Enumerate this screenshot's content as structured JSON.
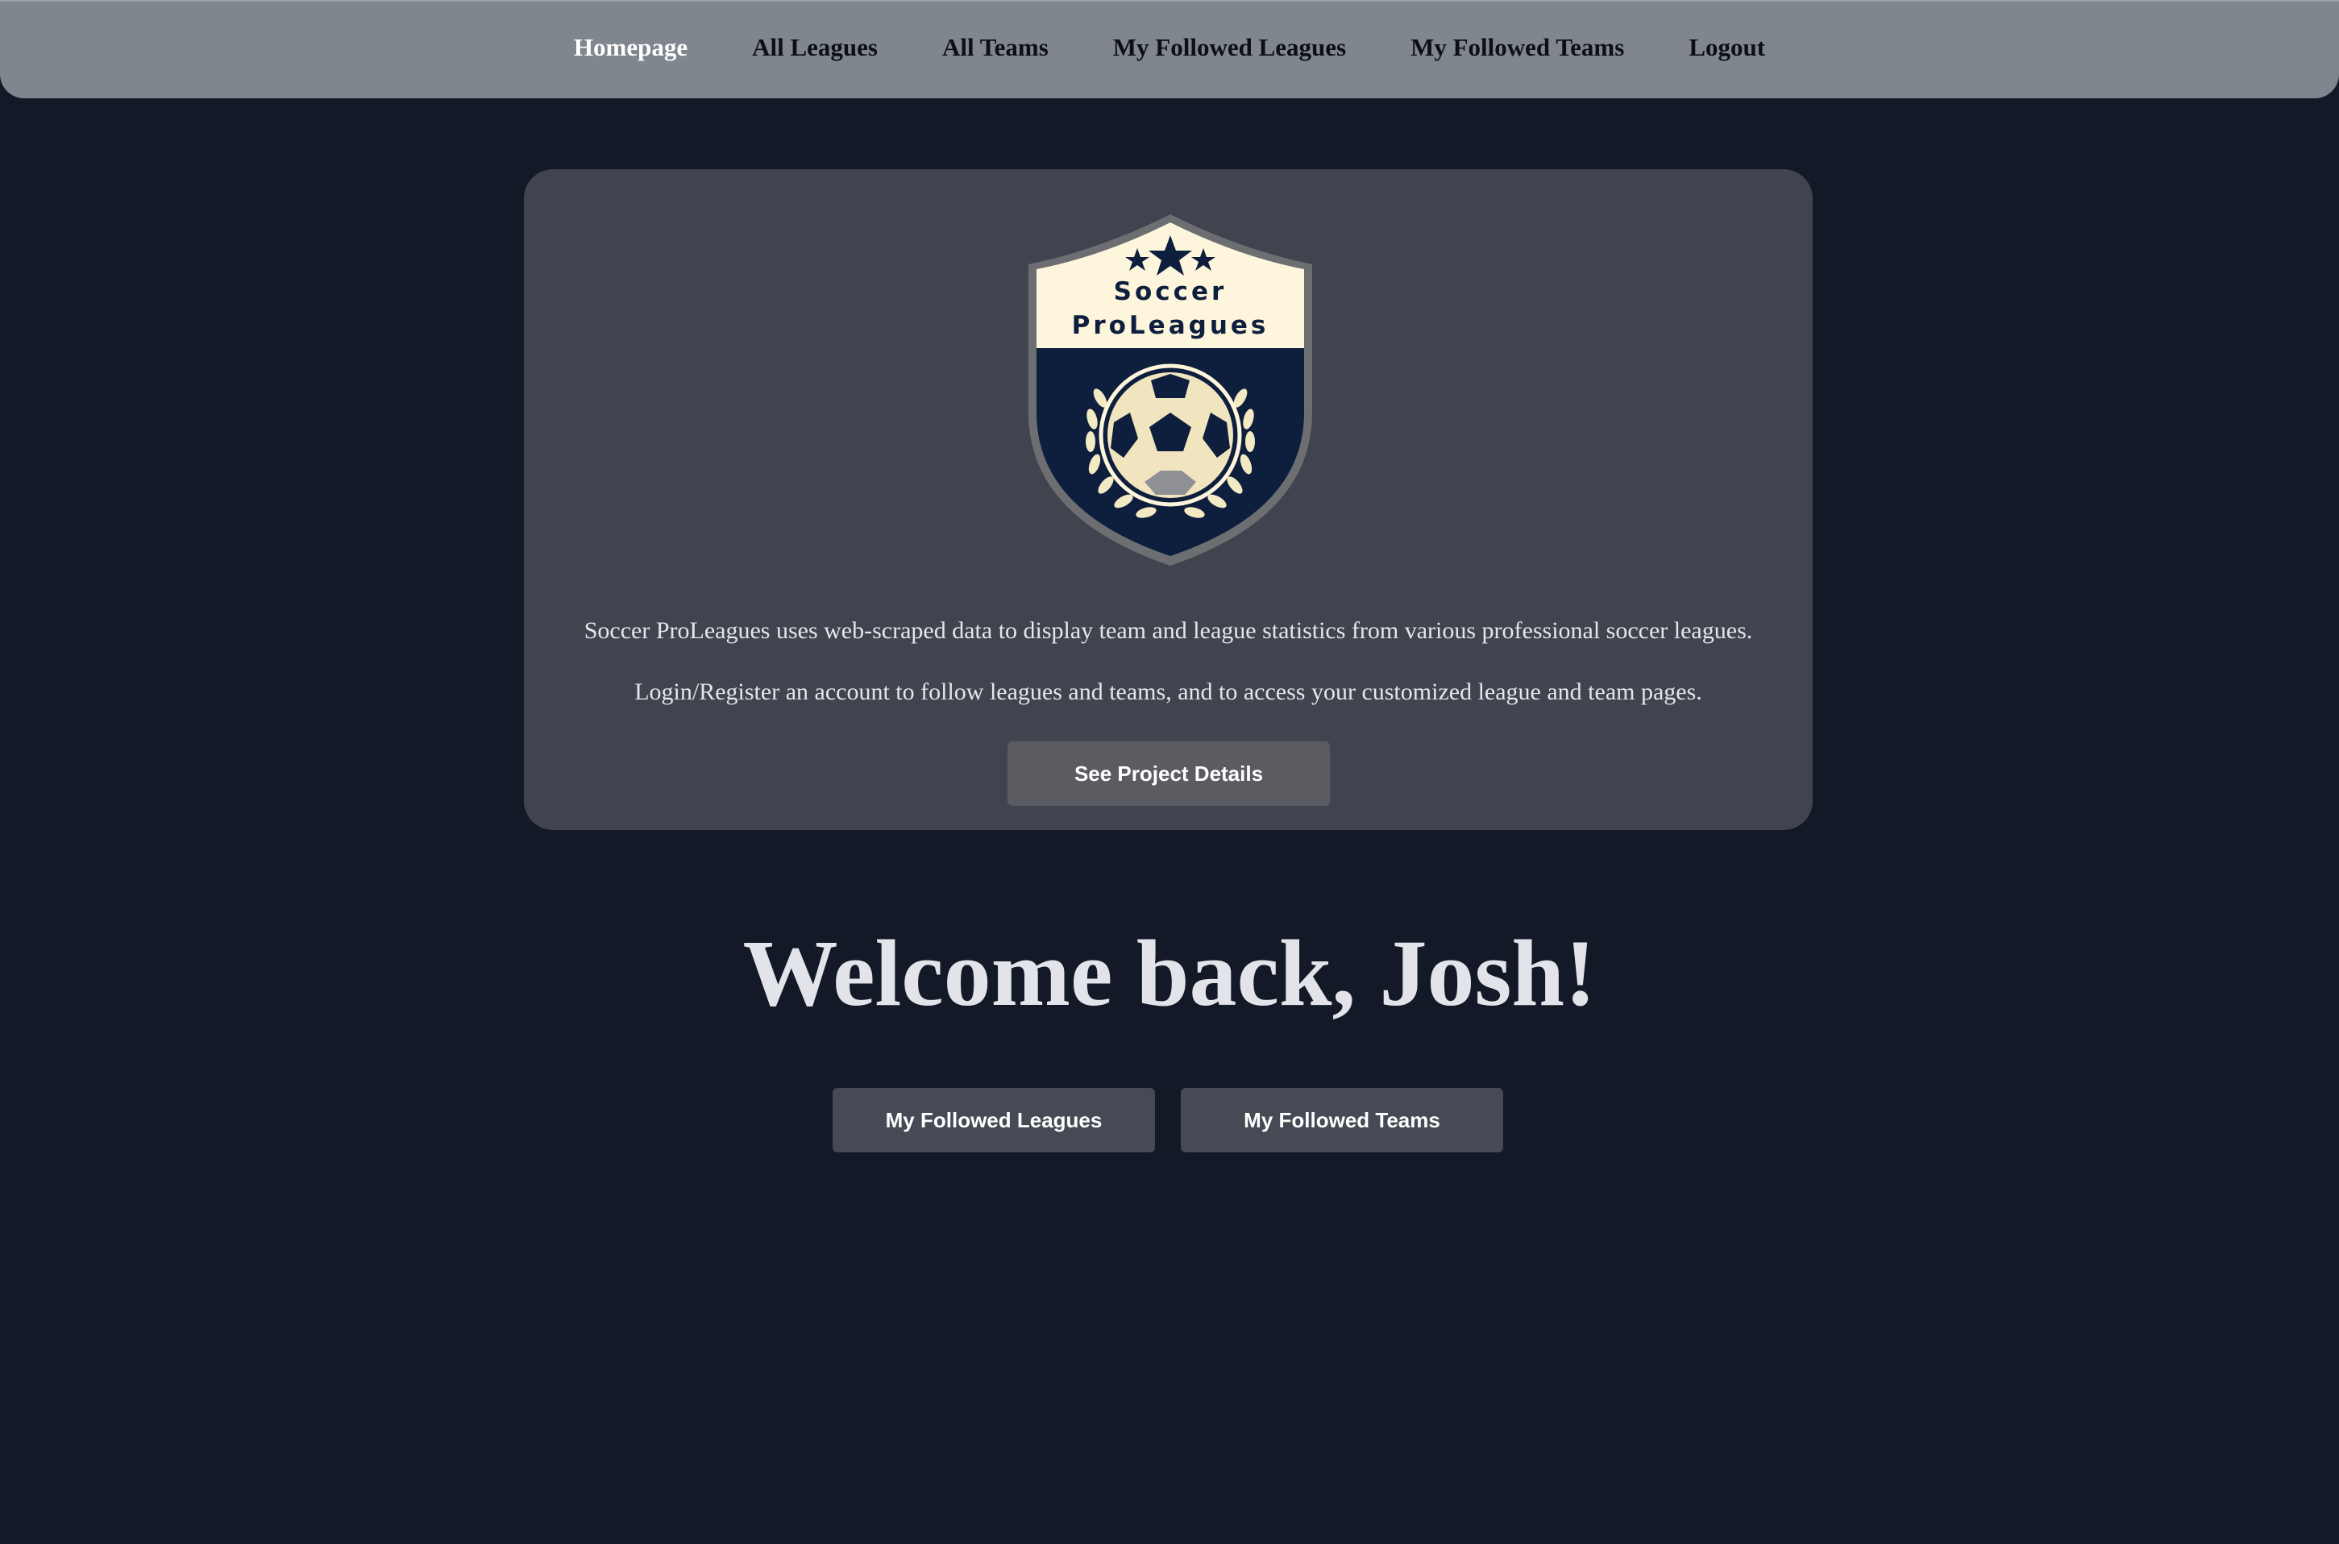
{
  "nav": {
    "items": [
      {
        "label": "Homepage",
        "active": true
      },
      {
        "label": "All Leagues",
        "active": false
      },
      {
        "label": "All Teams",
        "active": false
      },
      {
        "label": "My Followed Leagues",
        "active": false
      },
      {
        "label": "My Followed Teams",
        "active": false
      },
      {
        "label": "Logout",
        "active": false
      }
    ]
  },
  "logo": {
    "line1": "Soccer",
    "line2": "ProLeagues",
    "icon": "soccer-shield-logo"
  },
  "card": {
    "description_1": "Soccer ProLeagues uses web-scraped data to display team and league statistics from various professional soccer leagues.",
    "description_2": "Login/Register an account to follow leagues and teams, and to access your customized league and team pages.",
    "details_button": "See Project Details"
  },
  "welcome": {
    "heading": "Welcome back, Josh!",
    "leagues_button": "My Followed Leagues",
    "teams_button": "My Followed Teams"
  },
  "colors": {
    "background": "#131927",
    "navbar": "#7f868d",
    "card": "#40444f",
    "button": "#5a5c62",
    "logo_cream": "#fdf6dc",
    "logo_navy": "#0e1e3d"
  }
}
